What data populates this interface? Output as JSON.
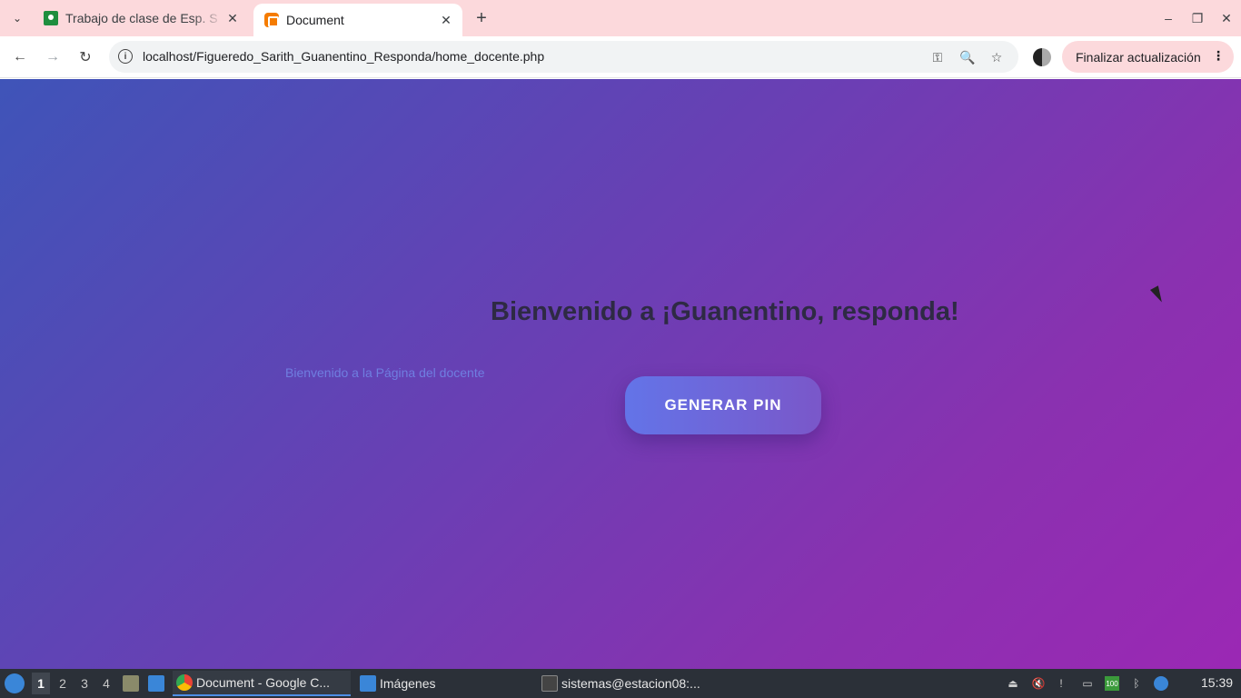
{
  "browser": {
    "tabs": [
      {
        "title": "Trabajo de clase de Esp. S",
        "close": "✕"
      },
      {
        "title": "Document",
        "close": "✕"
      }
    ],
    "tab_search_glyph": "⌄",
    "new_tab_glyph": "+",
    "window": {
      "minimize": "–",
      "maximize": "❐",
      "close": "✕"
    },
    "nav": {
      "back": "←",
      "forward": "→",
      "reload": "↻"
    },
    "url": "localhost/Figueredo_Sarith_Guanentino_Responda/home_docente.php",
    "info_glyph": "i",
    "omnibox_icons": {
      "key": "⚿",
      "zoom": "🔍",
      "bookmark": "☆"
    },
    "update_button": "Finalizar actualización",
    "menu_glyph": "⋮"
  },
  "page": {
    "welcome_note": "Bienvenido a la Página del docente",
    "heading": "Bienvenido a ¡Guanentino, responda!",
    "pin_button": "GENERAR PIN"
  },
  "taskbar": {
    "workspaces": [
      "1",
      "2",
      "3",
      "4"
    ],
    "tasks": [
      {
        "label": "Document - Google C..."
      },
      {
        "label": "Imágenes"
      },
      {
        "label": "sistemas@estacion08:..."
      }
    ],
    "clock": "15:39"
  },
  "colors": {
    "tabstrip": "#fcd9dc",
    "page_gradient_start": "#3f54b8",
    "page_gradient_end": "#9b28b4",
    "button_start": "#6374e8",
    "button_end": "#7a57c9"
  }
}
